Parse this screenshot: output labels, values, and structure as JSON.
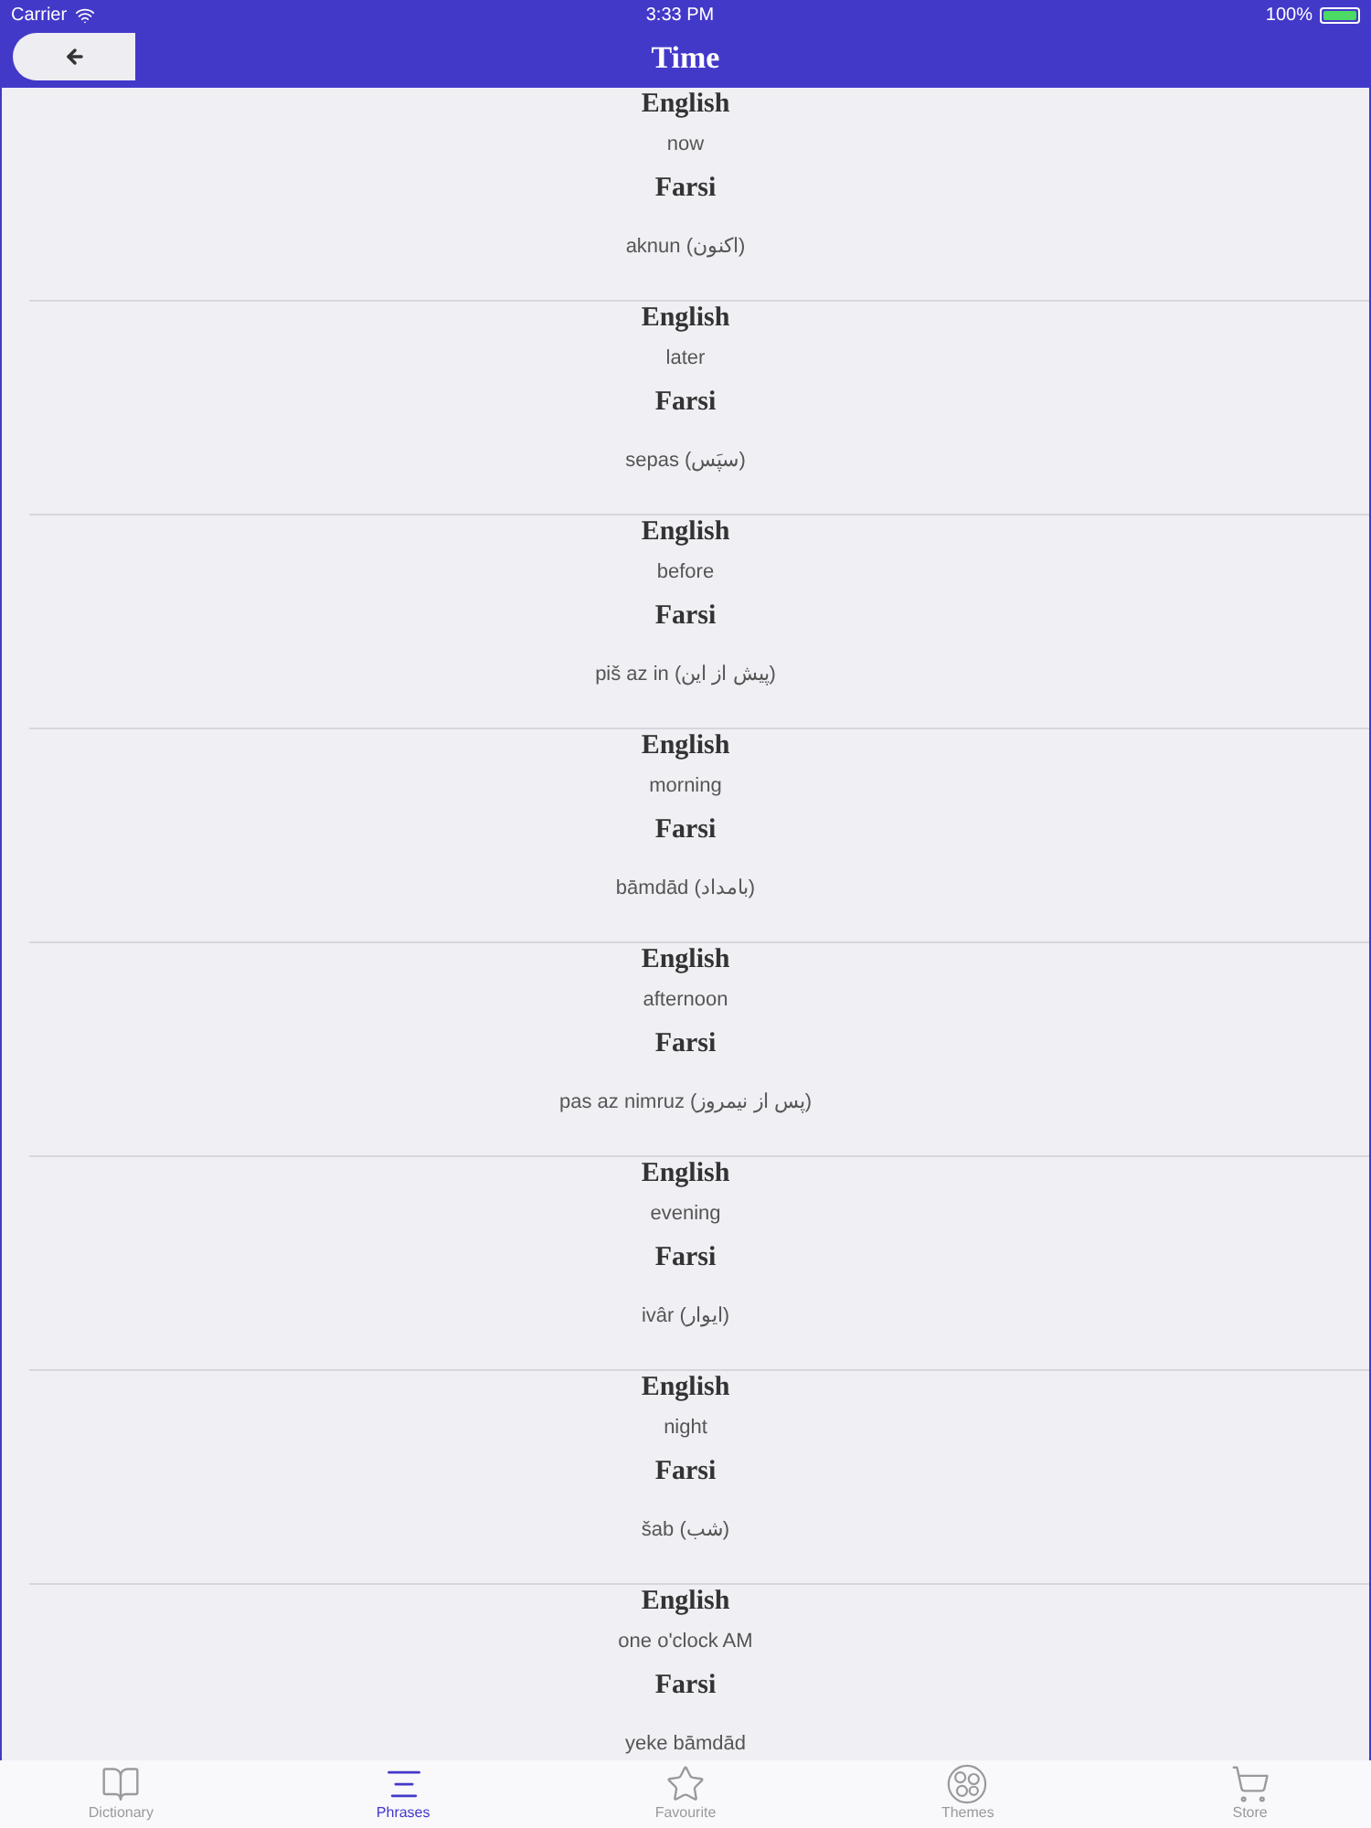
{
  "status_bar": {
    "carrier": "Carrier",
    "time": "3:33 PM",
    "battery": "100%"
  },
  "nav": {
    "title": "Time"
  },
  "phrases": [
    {
      "source_label": "English",
      "source": "now",
      "target_label": "Farsi",
      "target": "aknun (اکنون)"
    },
    {
      "source_label": "English",
      "source": "later",
      "target_label": "Farsi",
      "target": "sepas (سپَس)"
    },
    {
      "source_label": "English",
      "source": "before",
      "target_label": "Farsi",
      "target": "piš az in (پیش از این)"
    },
    {
      "source_label": "English",
      "source": "morning",
      "target_label": "Farsi",
      "target": "bāmdād (بامداد)"
    },
    {
      "source_label": "English",
      "source": "afternoon",
      "target_label": "Farsi",
      "target": "pas az nimruz (پس از نیمروز)"
    },
    {
      "source_label": "English",
      "source": "evening",
      "target_label": "Farsi",
      "target": "ivâr (ایوار)"
    },
    {
      "source_label": "English",
      "source": "night",
      "target_label": "Farsi",
      "target": "šab (شب)"
    },
    {
      "source_label": "English",
      "source": "one o'clock AM",
      "target_label": "Farsi",
      "target": "yeke bāmdād"
    }
  ],
  "tab_bar": [
    {
      "kind": "book",
      "label": "Dictionary",
      "selected": false
    },
    {
      "kind": "lines",
      "label": "Phrases",
      "selected": true
    },
    {
      "kind": "star",
      "label": "Favourite",
      "selected": false
    },
    {
      "kind": "circles",
      "label": "Themes",
      "selected": false
    },
    {
      "kind": "cart",
      "label": "Store",
      "selected": false
    }
  ]
}
